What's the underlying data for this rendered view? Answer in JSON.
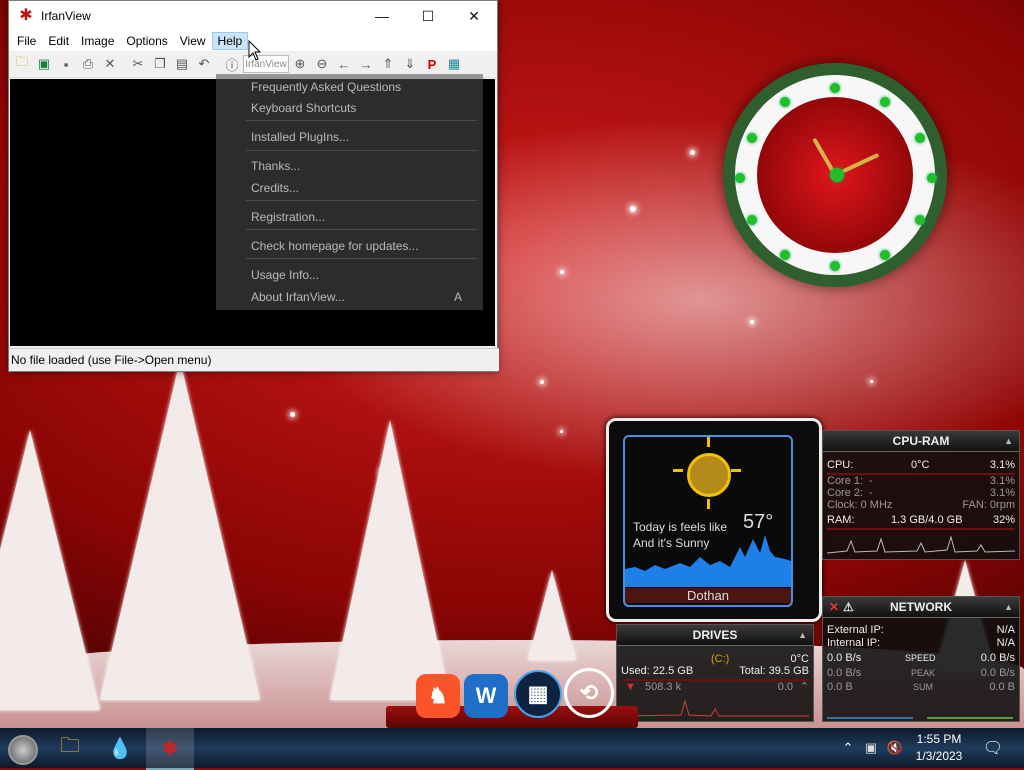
{
  "window": {
    "title": "IrfanView",
    "controls": {
      "minimize": "—",
      "maximize": "☐",
      "close": "✕"
    },
    "menu": [
      "File",
      "Edit",
      "Image",
      "Options",
      "View",
      "Help"
    ],
    "active_menu": "Help",
    "toolbar_field": "IrfanView",
    "status": "No file loaded (use File->Open menu)"
  },
  "help_menu": {
    "items": [
      "Frequently Asked Questions",
      "Keyboard Shortcuts",
      "Installed PlugIns...",
      "Thanks...",
      "Credits...",
      "Registration...",
      "Check homepage for updates...",
      "Usage Info...",
      "About IrfanView..."
    ],
    "about_shortcut": "A"
  },
  "weather": {
    "line1": "Today is feels like",
    "line2": "And it's Sunny",
    "temp": "57°",
    "city": "Dothan"
  },
  "cpu": {
    "title": "CPU-RAM",
    "cpu_label": "CPU:",
    "cpu_temp": "0°C",
    "cpu_pct": "3.1%",
    "core1_label": "Core 1:",
    "core1_val": "-",
    "core1_pct": "3.1%",
    "core2_label": "Core 2:",
    "core2_val": "-",
    "core2_pct": "3.1%",
    "clock": "Clock: 0 MHz",
    "fan": "FAN: 0rpm",
    "ram_label": "RAM:",
    "ram_val": "1.3 GB/4.0 GB",
    "ram_pct": "32%"
  },
  "network": {
    "title": "NETWORK",
    "ext_label": "External IP:",
    "ext_val": "N/A",
    "int_label": "Internal IP:",
    "int_val": "N/A",
    "speed_left": "0.0 B/s",
    "speed_label": "SPEED",
    "speed_right": "0.0 B/s",
    "peak_left": "0.0 B/s",
    "peak_label": "PEAK",
    "peak_right": "0.0 B/s",
    "sum_left": "0.0 B",
    "sum_label": "SUM",
    "sum_right": "0.0 B"
  },
  "drives": {
    "title": "DRIVES",
    "drive": "(C:)",
    "temp": "0°C",
    "used": "Used: 22.5 GB",
    "total": "Total: 39.5 GB",
    "read": "508.3 k",
    "write": "0.0"
  },
  "taskbar": {
    "time": "1:55 PM",
    "date": "1/3/2023"
  },
  "colors": {
    "accent": "#cce4f7",
    "wallpaper": "#d11a1a",
    "panel_bar": "#6b1010"
  }
}
